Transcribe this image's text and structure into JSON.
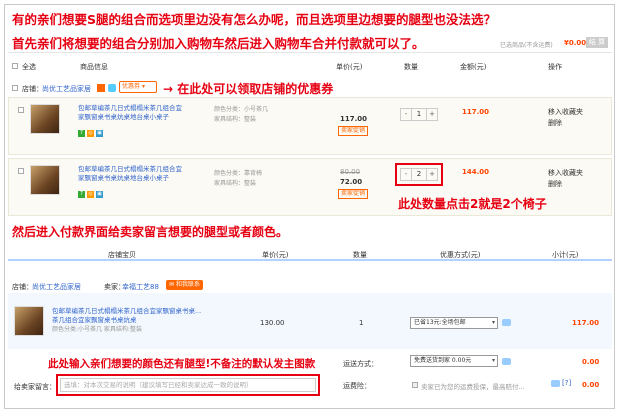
{
  "annotations": {
    "line1": "有的亲们想要S腿的组合而选项里边没有怎么办呢，而且选项里边想要的腿型也没法选？",
    "line2": "首先亲们将想要的组合分别加入购物车然后进入购物车合并付款就可以了。",
    "coupon_arrow": "→ 在此处可以领取店铺的优惠券",
    "qty_note": "此处数量点击2就是2个椅子",
    "message_note": "然后进入付款界面给卖家留言想要的腿型或者颜色。",
    "input_note": "此处输入亲们想要的颜色还有腿型!不备注的默认发主图款"
  },
  "cart": {
    "selected_label": "已选商品(不含运费)",
    "total": "¥0.00",
    "checkout_button": "结 算",
    "columns": [
      "全选",
      "商品信息",
      "单价(元)",
      "数量",
      "金额(元)",
      "操作"
    ],
    "shop_label": "店铺：",
    "shop_name": "尚优工艺品家居",
    "coupon_label": "优惠券",
    "items": [
      {
        "title": "包邮草编茶几日式榻榻米茶几组合宜家飘窗桌书桌炕桌地台桌小桌子",
        "color": "颜色分类：小号茶几",
        "structure": "家具结构：整装",
        "unit_price": "117.00",
        "seller_promo": "卖家促销",
        "qty": "1",
        "amount": "117.00",
        "action1": "移入收藏夹",
        "action2": "删除"
      },
      {
        "title": "包邮草编茶几日式榻榻米茶几组合宜家飘窗桌书桌炕桌地台桌小桌子",
        "color": "颜色分类：靠背椅",
        "structure": "家具结构：整装",
        "orig_price": "80.00",
        "unit_price": "72.00",
        "seller_promo": "卖家促销",
        "qty": "2",
        "amount": "144.00",
        "action1": "移入收藏夹",
        "action2": "删除"
      }
    ]
  },
  "order": {
    "columns": [
      "店铺宝贝",
      "单价(元)",
      "数量",
      "优惠方式(元)",
      "小计(元)"
    ],
    "shop_label": "店铺：",
    "shop_name": "尚优工艺品家居",
    "seller_label": "卖家：",
    "seller_name": "幸福工艺88",
    "contact": "和我联系",
    "item_title": "包邮草编茶几日式榻榻米茶几组合宜家飘窗桌书桌...",
    "item_line2": "茶几组合宜家飘窗桌书桌炕桌",
    "item_color": "颜色分类:小号茶几  家具结构:整装",
    "unit_price": "130.00",
    "qty": "1",
    "discount": "已省13元:全场包邮",
    "subtotal": "117.00",
    "shipping_label": "运送方式：",
    "shipping_option": "免费送货到家 0.00元",
    "shipping_price": "0.00",
    "insurance_label": "运费险：",
    "insurance_text": "卖家已为您的运费投保，最高赔付...",
    "insurance_price": "0.00",
    "message_label": "给卖家留言：",
    "message_placeholder": "选填：对本次交易的说明（建议填写已经和卖家达成一致的说明）"
  }
}
